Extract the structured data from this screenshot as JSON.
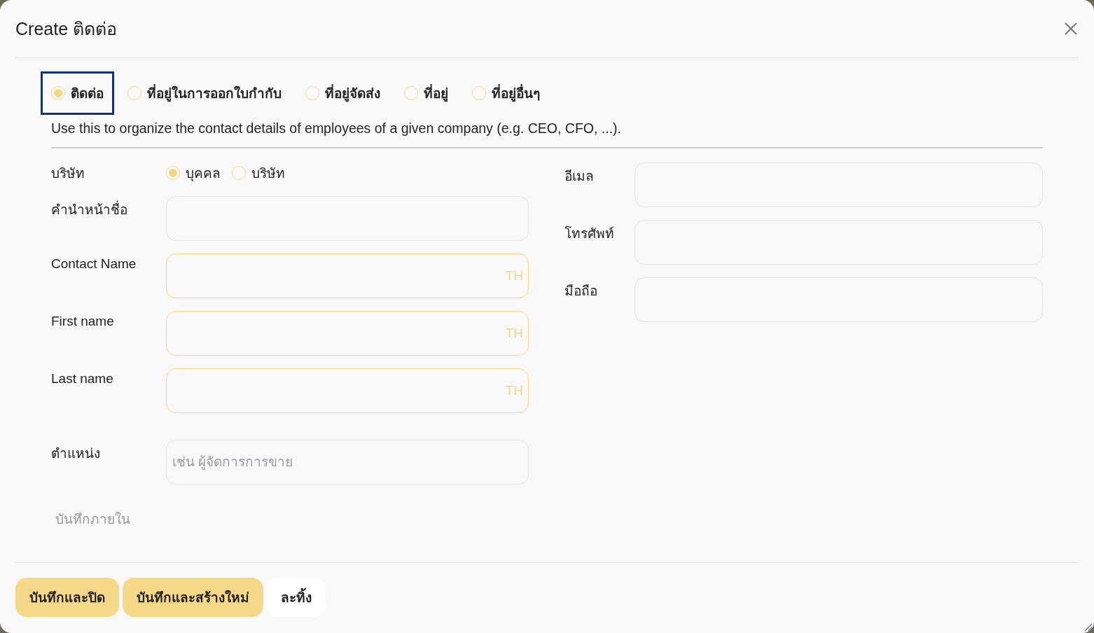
{
  "dialog": {
    "title": "Create ติดต่อ"
  },
  "address_types": [
    {
      "label": "ติดต่อ",
      "selected": true,
      "focused": true
    },
    {
      "label": "ที่อยู่ในการออกใบกำกับ",
      "selected": false,
      "focused": false
    },
    {
      "label": "ที่อยู่จัดส่ง",
      "selected": false,
      "focused": false
    },
    {
      "label": "ที่อยู่",
      "selected": false,
      "focused": false
    },
    {
      "label": "ที่อยู่อื่นๆ",
      "selected": false,
      "focused": false
    }
  ],
  "description": "Use this to organize the contact details of employees of a given company (e.g. CEO, CFO, ...).",
  "company_type": {
    "label": "บริษัท",
    "options": [
      {
        "label": "บุคคล",
        "selected": true
      },
      {
        "label": "บริษัท",
        "selected": false
      }
    ]
  },
  "left_fields": [
    {
      "label": "คำนำหน้าชื่อ",
      "required": false
    },
    {
      "label": "Contact Name",
      "required": true,
      "lang": "TH"
    },
    {
      "label": "First name",
      "required": true,
      "lang": "TH"
    },
    {
      "label": "Last name",
      "required": true,
      "lang": "TH"
    },
    {
      "label": "ตำแหน่ง",
      "required": false,
      "placeholder": "เช่น ผู้จัดการการขาย"
    }
  ],
  "right_fields": [
    {
      "label": "อีเมล",
      "required": false
    },
    {
      "label": "โทรศัพท์",
      "required": false
    },
    {
      "label": "มือถือ",
      "required": false
    }
  ],
  "note_tab": "บันทึกภายใน",
  "buttons": [
    {
      "label": "บันทึกและปิด",
      "kind": "primary"
    },
    {
      "label": "บันทึกและสร้างใหม่",
      "kind": "primary"
    },
    {
      "label": "ละทิ้ง",
      "kind": "secondary"
    }
  ]
}
